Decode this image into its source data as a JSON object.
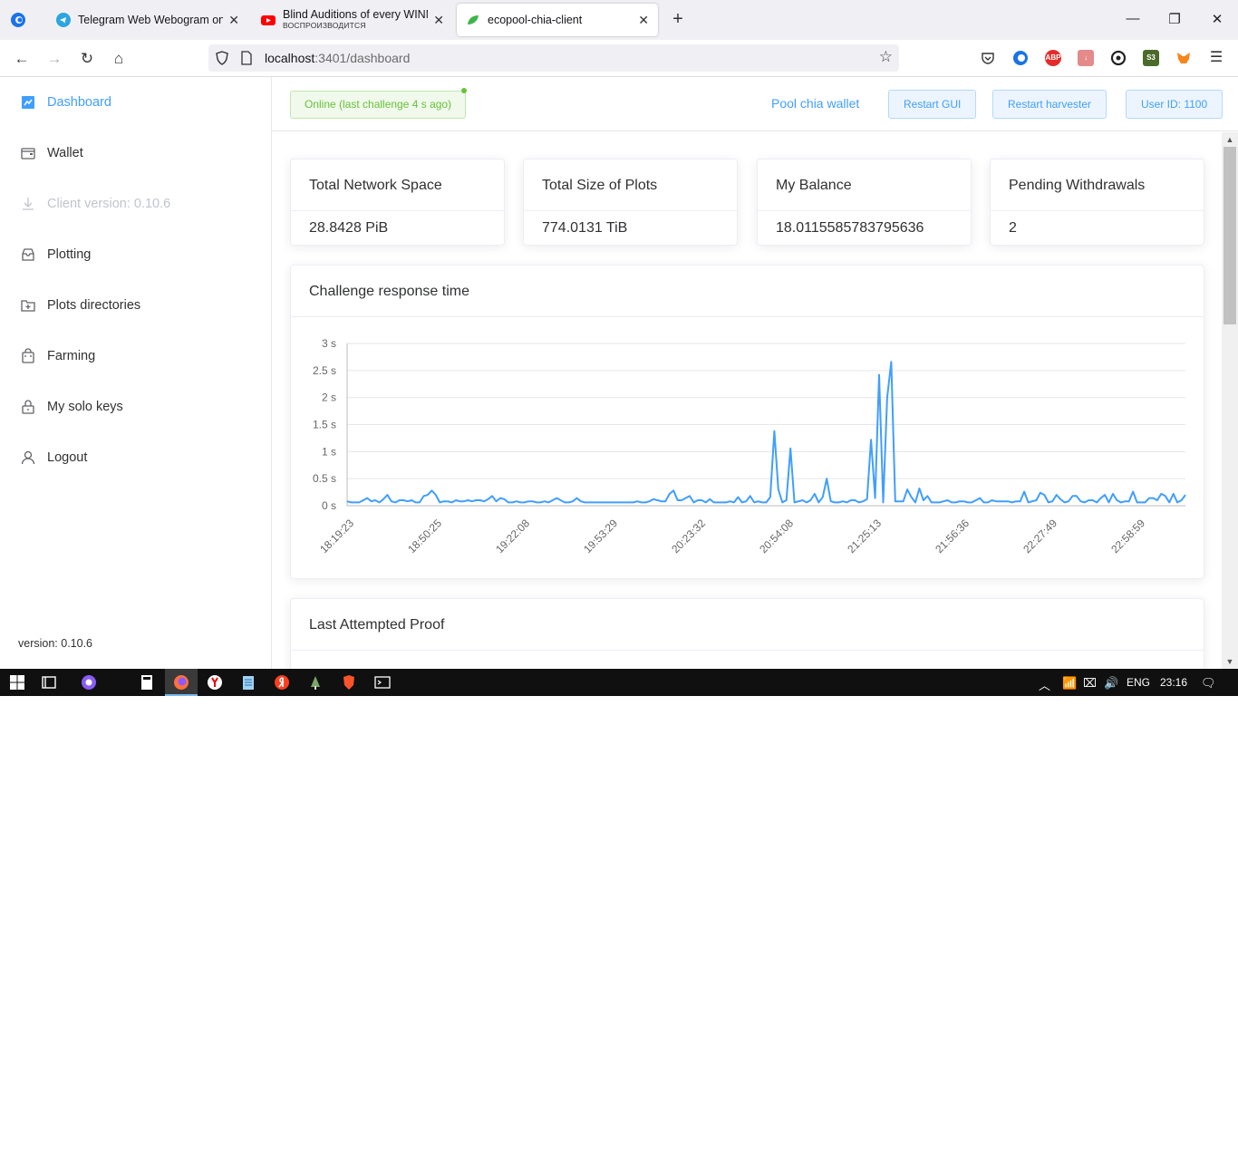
{
  "browser": {
    "tabs": [
      {
        "label": "Telegram Web Webogram online",
        "sub": ""
      },
      {
        "label": "Blind Auditions of every WINNER",
        "sub": "ВОСПРОИЗВОДИТСЯ"
      },
      {
        "label": "ecopool-chia-client",
        "sub": ""
      }
    ],
    "url_host": "localhost",
    "url_rest": ":3401/dashboard",
    "extensions": [
      "pocket-icon",
      "edge-icon",
      "abp-icon",
      "download-icon",
      "sync-icon",
      "s3-icon",
      "metamask-icon",
      "menu-icon"
    ],
    "abp_label": "ABP",
    "s3_label": "S3"
  },
  "sidebar": {
    "items": [
      {
        "label": "Dashboard",
        "icon": "chart-icon"
      },
      {
        "label": "Wallet",
        "icon": "wallet-icon"
      },
      {
        "label": "Client version: 0.10.6",
        "icon": "download-icon"
      },
      {
        "label": "Plotting",
        "icon": "box-icon"
      },
      {
        "label": "Plots directories",
        "icon": "folder-add-icon"
      },
      {
        "label": "Farming",
        "icon": "shopping-icon"
      },
      {
        "label": "My solo keys",
        "icon": "lock-icon"
      },
      {
        "label": "Logout",
        "icon": "user-icon"
      }
    ],
    "version": "version: 0.10.6"
  },
  "topbar": {
    "status": "Online (last challenge 4 s ago)",
    "pool_wallet": "Pool chia wallet",
    "restart_gui": "Restart GUI",
    "restart_harvester": "Restart harvester",
    "user_id": "User ID: 1100"
  },
  "stats": [
    {
      "title": "Total Network Space",
      "value": "28.8428 PiB"
    },
    {
      "title": "Total Size of Plots",
      "value": "774.0131 TiB"
    },
    {
      "title": "My Balance",
      "value": "18.0115585783795636"
    },
    {
      "title": "Pending Withdrawals",
      "value": "2"
    }
  ],
  "chart_card_title": "Challenge response time",
  "proof_card_title": "Last Attempted Proof",
  "colors": {
    "accent": "#409eff",
    "line": "#409eff",
    "success": "#67c23a"
  },
  "chart_data": {
    "type": "line",
    "title": "Challenge response time",
    "xlabel": "",
    "ylabel": "",
    "ylim": [
      0,
      3
    ],
    "yticks": [
      "0 s",
      "0.5 s",
      "1 s",
      "1.5 s",
      "2 s",
      "2.5 s",
      "3 s"
    ],
    "xticks": [
      "18:19:23",
      "18:50:25",
      "19:22:08",
      "19:53:29",
      "20:23:32",
      "20:54:08",
      "21:25:13",
      "21:56:36",
      "22:27:49",
      "22:58:59"
    ],
    "grid": true,
    "series": [
      {
        "values": [
          0.08,
          0.06,
          0.06,
          0.06,
          0.1,
          0.14,
          0.08,
          0.1,
          0.06,
          0.12,
          0.2,
          0.08,
          0.06,
          0.1,
          0.1,
          0.08,
          0.1,
          0.06,
          0.06,
          0.18,
          0.2,
          0.28,
          0.2,
          0.06,
          0.08,
          0.08,
          0.06,
          0.1,
          0.08,
          0.08,
          0.1,
          0.08,
          0.1,
          0.1,
          0.08,
          0.12,
          0.18,
          0.08,
          0.14,
          0.12,
          0.06,
          0.06,
          0.08,
          0.06,
          0.06,
          0.08,
          0.08,
          0.06,
          0.06,
          0.08,
          0.06,
          0.1,
          0.14,
          0.1,
          0.06,
          0.06,
          0.08,
          0.14,
          0.08,
          0.06,
          0.06,
          0.06,
          0.06,
          0.06,
          0.06,
          0.06,
          0.06,
          0.06,
          0.06,
          0.06,
          0.06,
          0.06,
          0.08,
          0.06,
          0.06,
          0.08,
          0.12,
          0.1,
          0.08,
          0.08,
          0.22,
          0.28,
          0.1,
          0.1,
          0.14,
          0.18,
          0.06,
          0.1,
          0.1,
          0.06,
          0.12,
          0.06,
          0.06,
          0.06,
          0.06,
          0.08,
          0.06,
          0.16,
          0.06,
          0.08,
          0.18,
          0.06,
          0.08,
          0.06,
          0.06,
          0.16,
          1.38,
          0.3,
          0.06,
          0.1,
          1.06,
          0.06,
          0.08,
          0.1,
          0.06,
          0.1,
          0.22,
          0.06,
          0.16,
          0.5,
          0.08,
          0.06,
          0.06,
          0.08,
          0.06,
          0.1,
          0.1,
          0.06,
          0.08,
          0.12,
          1.22,
          0.14,
          2.42,
          0.06,
          2.0,
          2.66,
          0.08,
          0.08,
          0.08,
          0.3,
          0.16,
          0.06,
          0.32,
          0.1,
          0.18,
          0.06,
          0.06,
          0.06,
          0.08,
          0.1,
          0.06,
          0.06,
          0.08,
          0.08,
          0.06,
          0.06,
          0.1,
          0.14,
          0.06,
          0.06,
          0.1,
          0.08,
          0.08,
          0.08,
          0.08,
          0.06,
          0.08,
          0.08,
          0.26,
          0.06,
          0.08,
          0.1,
          0.24,
          0.2,
          0.06,
          0.08,
          0.2,
          0.12,
          0.06,
          0.08,
          0.18,
          0.18,
          0.08,
          0.06,
          0.1,
          0.1,
          0.06,
          0.14,
          0.2,
          0.06,
          0.22,
          0.1,
          0.06,
          0.08,
          0.08,
          0.26,
          0.06,
          0.06,
          0.06,
          0.14,
          0.14,
          0.1,
          0.22,
          0.18,
          0.06,
          0.22,
          0.06,
          0.1,
          0.2
        ]
      }
    ]
  },
  "taskbar": {
    "lang": "ENG",
    "time": "23:16"
  }
}
